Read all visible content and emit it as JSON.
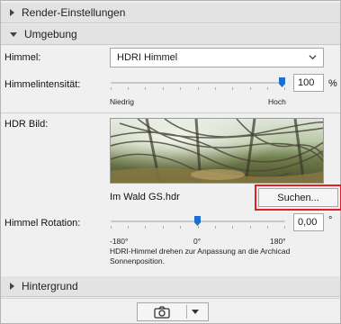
{
  "sections": {
    "render": {
      "label": "Render-Einstellungen",
      "state": "collapsed"
    },
    "environment": {
      "label": "Umgebung",
      "state": "expanded"
    },
    "background": {
      "label": "Hintergrund",
      "state": "collapsed"
    }
  },
  "sky": {
    "label": "Himmel:",
    "selected": "HDRI Himmel"
  },
  "intensity": {
    "label": "Himmelintensität:",
    "value": "100",
    "unit": "%",
    "min_label": "Niedrig",
    "max_label": "Hoch",
    "level_fraction": 1.0
  },
  "hdr": {
    "label": "HDR Bild:",
    "filename": "Im Wald GS.hdr",
    "browse_label": "Suchen..."
  },
  "rotation": {
    "label": "Himmel Rotation:",
    "value": "0,00",
    "unit": "°",
    "ticks": [
      "-180°",
      "0°",
      "180°"
    ],
    "level_fraction": 0.5,
    "hint": "HDRI-Himmel drehen zur Anpassung an die Archicad Sonnenposition."
  },
  "colors": {
    "accent": "#1f6fd1",
    "highlight": "#e31e24"
  },
  "footer": {
    "camera_icon": "camera-icon",
    "menu_icon": "chevron-down-icon"
  }
}
